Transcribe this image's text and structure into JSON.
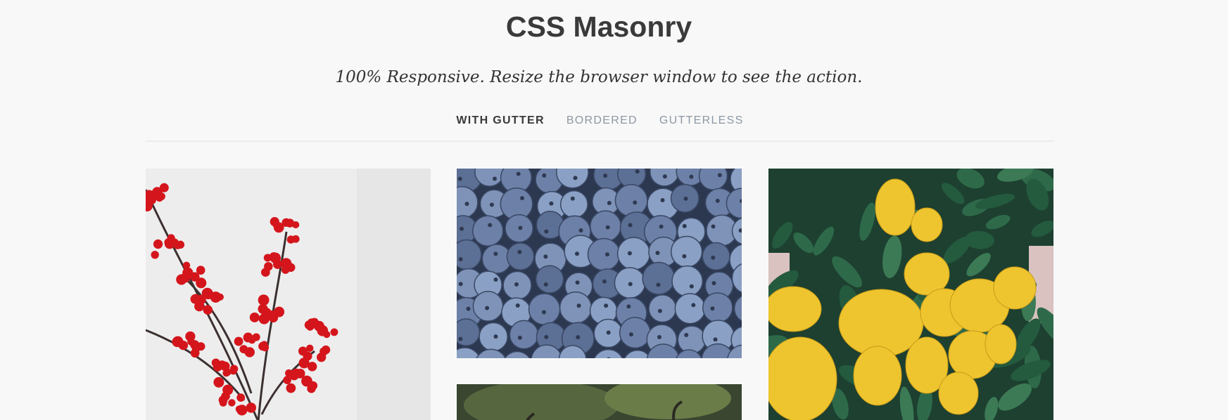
{
  "header": {
    "title": "CSS Masonry",
    "subtitle": "100% Responsive. Resize the browser window to see the action."
  },
  "tabs": [
    {
      "label": "WITH GUTTER",
      "active": true
    },
    {
      "label": "BORDERED",
      "active": false
    },
    {
      "label": "GUTTERLESS",
      "active": false
    }
  ],
  "gallery": {
    "items": [
      {
        "subject": "red berries on branch"
      },
      {
        "subject": "blueberries"
      },
      {
        "subject": "green foliage"
      },
      {
        "subject": "lemon tree"
      }
    ]
  },
  "colors": {
    "background": "#f8f8f8",
    "text_dark": "#3a3a3a",
    "tab_inactive": "#8d97a3",
    "divider": "#ececec"
  }
}
